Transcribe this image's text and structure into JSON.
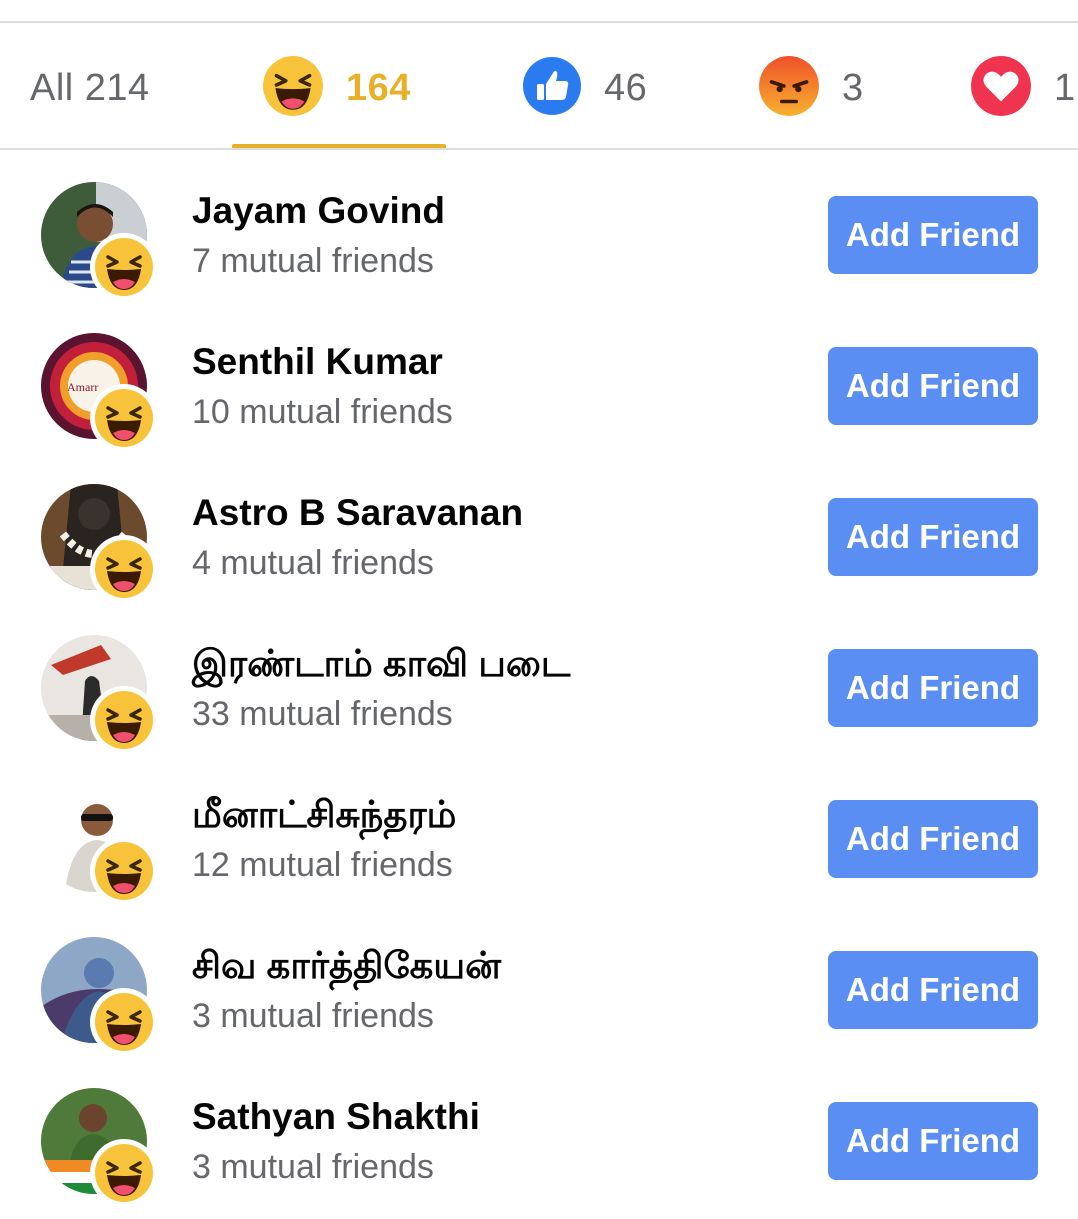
{
  "tabs": {
    "all": "All 214",
    "haha": "164",
    "like": "46",
    "angry": "3",
    "love": "1"
  },
  "colors": {
    "accent": "#e8b027",
    "button": "#5b8ef2",
    "secondary_text": "#65676b"
  },
  "people": [
    {
      "name": "Jayam Govind",
      "mutual": "7 mutual friends",
      "button": "Add Friend",
      "reaction": "haha-icon"
    },
    {
      "name": "Senthil Kumar",
      "mutual": "10 mutual friends",
      "button": "Add Friend",
      "reaction": "haha-icon"
    },
    {
      "name": "Astro B Saravanan",
      "mutual": "4 mutual friends",
      "button": "Add Friend",
      "reaction": "haha-icon"
    },
    {
      "name": "இரண்டாம் காவி படை",
      "mutual": "33 mutual friends",
      "button": "Add Friend",
      "reaction": "haha-icon"
    },
    {
      "name": "மீனாட்சிசுந்தரம்",
      "mutual": "12 mutual friends",
      "button": "Add Friend",
      "reaction": "haha-icon"
    },
    {
      "name": "சிவ கார்த்திகேயன்",
      "mutual": "3 mutual friends",
      "button": "Add Friend",
      "reaction": "haha-icon"
    },
    {
      "name": "Sathyan Shakthi",
      "mutual": "3 mutual friends",
      "button": "Add Friend",
      "reaction": "haha-icon"
    }
  ]
}
